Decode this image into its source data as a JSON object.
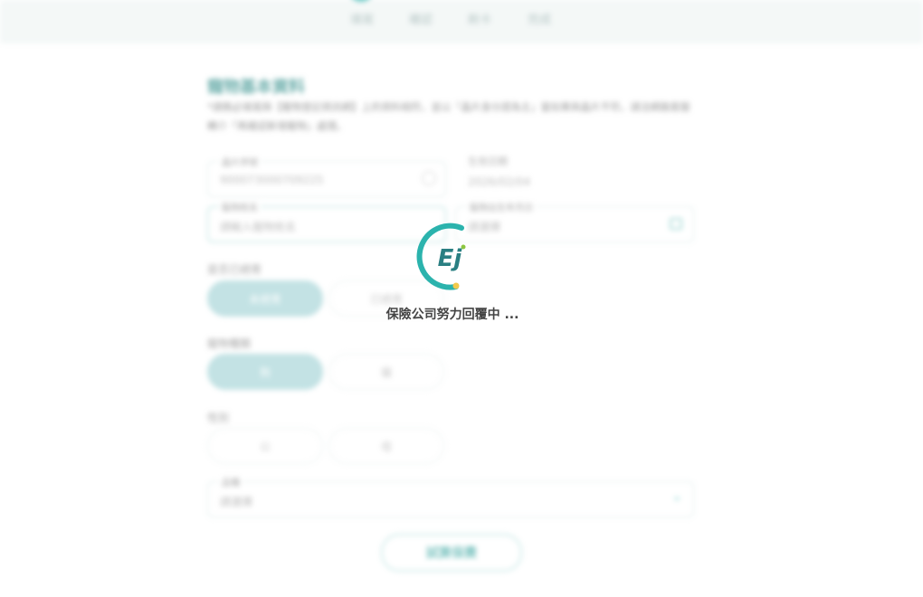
{
  "stepper": {
    "steps": [
      "填寫",
      "確認",
      "刷卡",
      "完成"
    ]
  },
  "pet_form": {
    "title": "寵物基本資料",
    "notice": "*請務必填寫與【寵物登記資訊網】上的資料相符，並以「晶片身分證為主」當如果與晶片不符，請洽網路客服轉介「再確認新增寵物」處理。",
    "chip_number": {
      "label": "晶片序號",
      "value": "900073000709225"
    },
    "birthday": {
      "label": "生效日期",
      "value": "2026/02/04"
    },
    "pet_name": {
      "label": "寵物姓名",
      "placeholder": "請輸入寵物姓名"
    },
    "pet_birth": {
      "label": "寵物出生年月日",
      "placeholder": "請選擇"
    },
    "neutered": {
      "label": "是否已絕育",
      "options": [
        "未絕育",
        "已絕育"
      ]
    },
    "species": {
      "label": "寵物種類",
      "options": [
        "狗",
        "貓"
      ]
    },
    "gender": {
      "label": "性別",
      "options": [
        "公",
        "母"
      ]
    },
    "breed": {
      "label": "品種",
      "placeholder": "請選擇"
    },
    "submit_label": "試算保費"
  },
  "loading": {
    "text": "保險公司努力回覆中 ...",
    "logo_text": "Ej"
  },
  "colors": {
    "accent": "#2bb3ad",
    "selected_pill": "#a3d3d6",
    "logo_dot": "#f2c94c"
  }
}
